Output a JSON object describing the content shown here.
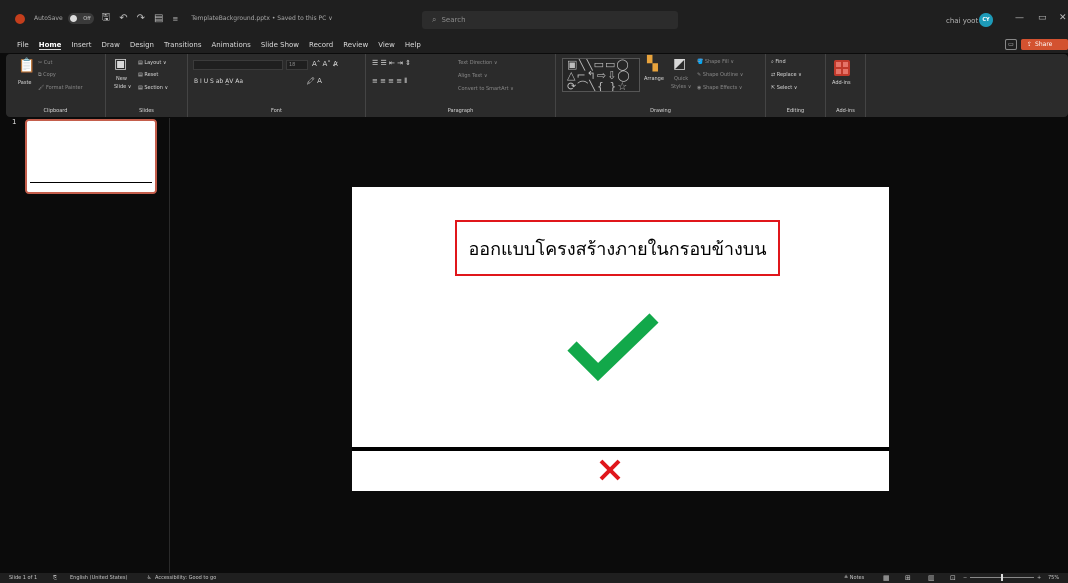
{
  "titlebar": {
    "autosave_label": "AutoSave",
    "autosave_state": "Off",
    "doc_title": "TemplateBackground.pptx • Saved to this PC ∨",
    "search_placeholder": "Search",
    "user_name": "chai yoot",
    "user_initials": "CY"
  },
  "menu": {
    "tabs": [
      "File",
      "Home",
      "Insert",
      "Draw",
      "Design",
      "Transitions",
      "Animations",
      "Slide Show",
      "Record",
      "Review",
      "View",
      "Help"
    ],
    "active": "Home",
    "share_label": "Share"
  },
  "ribbon": {
    "clipboard": {
      "label": "Clipboard",
      "paste": "Paste",
      "cut": "Cut",
      "copy": "Copy",
      "format_painter": "Format Painter"
    },
    "slides": {
      "label": "Slides",
      "new_slide": "New",
      "new_slide_2": "Slide ∨",
      "layout": "Layout ∨",
      "reset": "Reset",
      "section": "Section ∨"
    },
    "font": {
      "label": "Font",
      "size": "18"
    },
    "paragraph": {
      "label": "Paragraph",
      "text_direction": "Text Direction ∨",
      "align_text": "Align Text ∨",
      "convert_smartart": "Convert to SmartArt ∨"
    },
    "drawing": {
      "label": "Drawing",
      "arrange": "Arrange",
      "quick_styles": "Quick",
      "quick_styles_2": "Styles ∨",
      "shape_fill": "Shape Fill ∨",
      "shape_outline": "Shape Outline ∨",
      "shape_effects": "Shape Effects ∨"
    },
    "editing": {
      "label": "Editing",
      "find": "Find",
      "replace": "Replace ∨",
      "select": "Select ∨"
    },
    "addins": {
      "label": "Add-ins",
      "button": "Add-ins"
    }
  },
  "thumbnails": {
    "slide_number": "1"
  },
  "slide": {
    "text": "ออกแบบโครงสร้างภายในกรอบข้างบน",
    "check_color": "#12a84a",
    "x_color": "#e0161b",
    "box_border_color": "#e0161b"
  },
  "statusbar": {
    "slide_info": "Slide 1 of 1",
    "language": "English (United States)",
    "accessibility": "Accessibility: Good to go",
    "notes": "Notes",
    "zoom": "75%"
  },
  "colors": {
    "share": "#d35230",
    "accent": "#c43e1c"
  }
}
